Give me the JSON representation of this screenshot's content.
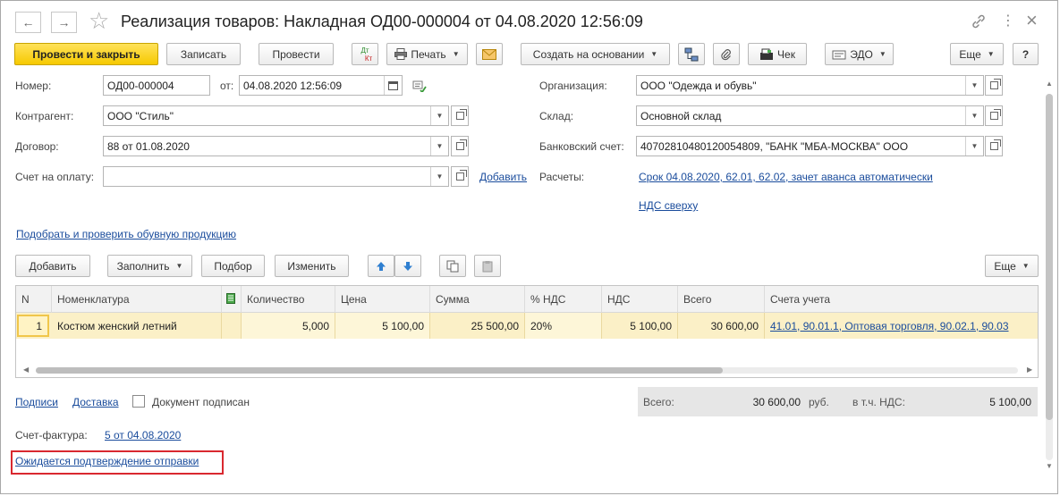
{
  "window": {
    "title": "Реализация товаров: Накладная ОД00-000004 от 04.08.2020 12:56:09",
    "nav_back": "←",
    "nav_forward": "→",
    "star": "☆",
    "link_icon": "link-icon",
    "more_icon": "⋮",
    "close": "×"
  },
  "toolbar": {
    "post_close": "Провести и закрыть",
    "save": "Записать",
    "post": "Провести",
    "dtkt_dt": "Дт",
    "dtkt_kt": "Кт",
    "print": "Печать",
    "create_based": "Создать на основании",
    "check": "Чек",
    "edo": "ЭДО",
    "more": "Еще",
    "help": "?"
  },
  "header": {
    "number_label": "Номер:",
    "number_value": "ОД00-000004",
    "date_label": "от:",
    "date_value": "04.08.2020 12:56:09",
    "counterparty_label": "Контрагент:",
    "counterparty_value": "ООО \"Стиль\"",
    "contract_label": "Договор:",
    "contract_value": "88 от 01.08.2020",
    "invoice_label": "Счет на оплату:",
    "invoice_value": "",
    "add_link": "Добавить",
    "org_label": "Организация:",
    "org_value": "ООО \"Одежда и обувь\"",
    "warehouse_label": "Склад:",
    "warehouse_value": "Основной склад",
    "bank_label": "Банковский счет:",
    "bank_value": "40702810480120054809, \"БАНК \"МБА-МОСКВА\" ООО",
    "settlements_label": "Расчеты:",
    "settlements_link": "Срок 04.08.2020, 62.01, 62.02, зачет аванса автоматически",
    "vat_link": "НДС сверху",
    "shoes_link": "Подобрать и проверить обувную продукцию"
  },
  "table_toolbar": {
    "add": "Добавить",
    "fill": "Заполнить",
    "pick": "Подбор",
    "edit": "Изменить",
    "more": "Еще"
  },
  "table": {
    "columns": [
      "N",
      "Номенклатура",
      "Количество",
      "Цена",
      "Сумма",
      "% НДС",
      "НДС",
      "Всего",
      "Счета учета"
    ],
    "rows": [
      {
        "n": "1",
        "item": "Костюм женский летний",
        "qty": "5,000",
        "price": "5 100,00",
        "sum": "25 500,00",
        "vat_rate": "20%",
        "vat": "5 100,00",
        "total": "30 600,00",
        "accounts": "41.01, 90.01.1, Оптовая торговля, 90.02.1, 90.03"
      }
    ]
  },
  "footer": {
    "signatures_link": "Подписи",
    "delivery_link": "Доставка",
    "signed_label": "Документ подписан",
    "total_label": "Всего:",
    "total_value": "30 600,00",
    "currency": "руб.",
    "vat_incl_label": "в т.ч. НДС:",
    "vat_value": "5 100,00",
    "invoice_label": "Счет-фактура:",
    "invoice_link": "5 от 04.08.2020",
    "status_link": "Ожидается подтверждение отправки"
  },
  "colors": {
    "primary_button": "#f6c900",
    "selected_row": "#fbf0c7",
    "link": "#1a4c9c",
    "highlight_border": "#d9282f"
  }
}
